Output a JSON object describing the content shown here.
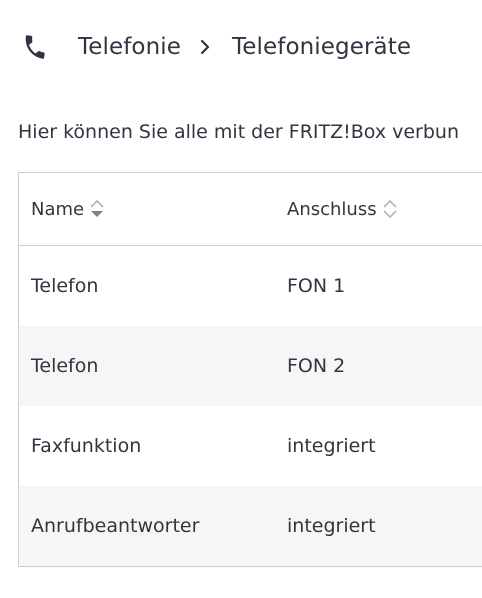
{
  "breadcrumb": {
    "icon": "phone-icon",
    "section": "Telefonie",
    "separator_icon": "chevron-right-icon",
    "page": "Telefoniegeräte"
  },
  "intro_text": "Hier können Sie alle mit der FRITZ!Box verbun",
  "table": {
    "columns": [
      {
        "label": "Name",
        "sort_icon": "sort-icon",
        "sort_state": "descending"
      },
      {
        "label": "Anschluss",
        "sort_icon": "sort-icon",
        "sort_state": "none"
      }
    ],
    "rows": [
      {
        "name": "Telefon",
        "port": "FON 1"
      },
      {
        "name": "Telefon",
        "port": "FON 2"
      },
      {
        "name": "Faxfunktion",
        "port": "integriert"
      },
      {
        "name": "Anrufbeantworter",
        "port": "integriert"
      }
    ]
  },
  "colors": {
    "text": "#2f3640",
    "border": "#c8cfd4",
    "row_alt": "#f6f6f6",
    "sort_active": "#7b8087",
    "sort_inactive": "#b4b9be"
  }
}
